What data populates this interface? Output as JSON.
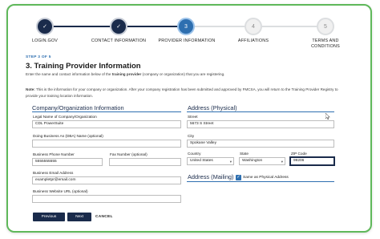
{
  "stepper": {
    "steps": [
      {
        "label": "LOGIN.GOV",
        "state": "done",
        "glyph": "✓"
      },
      {
        "label": "CONTACT INFORMATION",
        "state": "done",
        "glyph": "✓"
      },
      {
        "label": "PROVIDER INFORMATION",
        "state": "current",
        "glyph": "3"
      },
      {
        "label": "AFFILIATIONS",
        "state": "todo",
        "glyph": "4"
      },
      {
        "label_line1": "TERMS AND",
        "label_line2": "CONDITIONS",
        "state": "todo",
        "glyph": "5"
      }
    ]
  },
  "header": {
    "step_count": "STEP 3 OF 5",
    "title": "3. Training Provider Information",
    "intro_pre": "Enter the name and contact information below of the ",
    "intro_bold": "training provider",
    "intro_post": " (company or organization) that you are registering.",
    "note_label": "Note:",
    "note_text": " This is the information for your company or organization. After your company registration has been submitted and approved by FMCSA, you will return to the Training Provider Registry to provide your training location information."
  },
  "company": {
    "heading": "Company/Organization Information",
    "legal_name_label": "Legal Name of Company/Organization",
    "legal_name_value": "CDL PowerSuite",
    "dba_label": "Doing Business As (DBA) Name (optional)",
    "dba_value": "",
    "phone_label": "Business Phone Number",
    "phone_value": "5555555555",
    "fax_label": "Fax Number (optional)",
    "fax_value": "",
    "email_label": "Business Email Address",
    "email_value": "exampletpr@email.com",
    "website_label": "Business Website URL (optional)",
    "website_value": ""
  },
  "address": {
    "heading": "Address (Physical)",
    "street_label": "Street",
    "street_value": "5673 S Street",
    "city_label": "City",
    "city_value": "Spokane Valley",
    "country_label": "Country",
    "country_value": "United States",
    "state_label": "State",
    "state_value": "Washington",
    "zip_label": "ZIP Code",
    "zip_value": "99206",
    "mailing_heading": "Address (Mailing)",
    "same_as_physical_label": "Same as Physical Address",
    "same_as_physical_checked": true
  },
  "actions": {
    "previous_label": "Previous",
    "next_label": "Next",
    "cancel_label": "CANCEL"
  },
  "colors": {
    "navy": "#1a2b4b",
    "blue": "#2e6fb0",
    "frame_green": "#5fb85a"
  }
}
